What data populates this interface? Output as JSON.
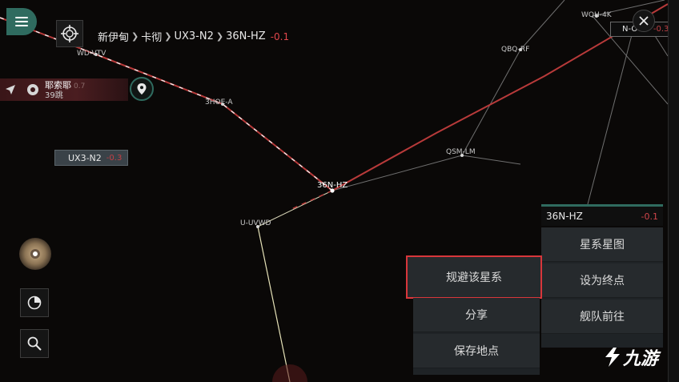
{
  "breadcrumb": {
    "items": [
      "新伊甸",
      "卡彻",
      "UX3-N2",
      "36N-HZ"
    ],
    "security": "-0.1"
  },
  "route": {
    "destination": "耶索耶",
    "security": "0.7",
    "jumps": "39跳"
  },
  "map": {
    "systems": [
      "WD-VTV",
      "3HOE-A",
      "36N-HZ",
      "U-UVWD",
      "QSM-LM",
      "QBQ-RF",
      "WQH-4K"
    ]
  },
  "tags": {
    "ux3": {
      "name": "UX3-N2",
      "security": "-0.3"
    },
    "nogii": {
      "name": "N-OGII",
      "security": "-0.3"
    }
  },
  "panel": {
    "system_name": "36N-HZ",
    "security": "-0.1",
    "right_actions": [
      "星系星图",
      "设为终点",
      "舰队前往"
    ],
    "left_actions": [
      "规避该星系",
      "分享",
      "保存地点"
    ]
  },
  "watermark": {
    "text": "九游"
  },
  "colors": {
    "accent": "#2f6b5f",
    "security_negative": "#d0454a",
    "highlight_box": "#d8363b",
    "route_line": "#b83a3a"
  },
  "icons": {
    "menu": "hamburger-icon",
    "target": "crosshair-icon",
    "pin": "location-pin-icon",
    "close": "close-icon",
    "history": "pie-chart-icon",
    "search": "search-icon"
  }
}
